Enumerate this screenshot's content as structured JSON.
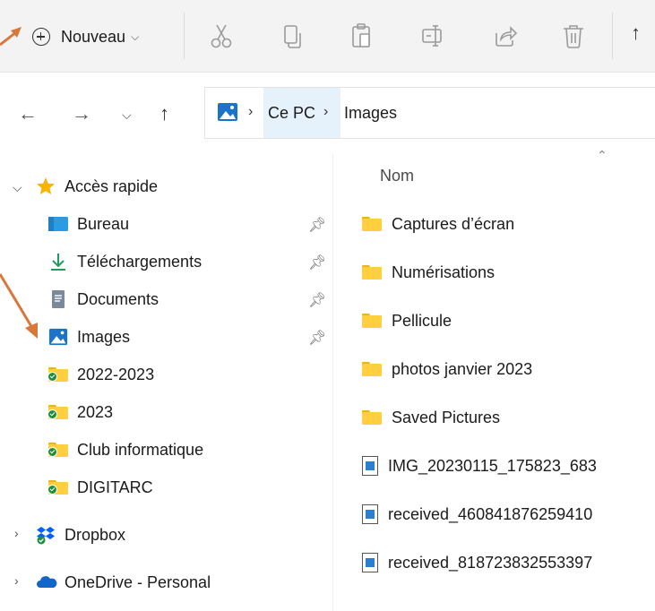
{
  "toolbar": {
    "new_label": "Nouveau",
    "icons": [
      "cut-icon",
      "copy-icon",
      "paste-icon",
      "rename-icon",
      "share-icon",
      "delete-icon",
      "sort-icon"
    ]
  },
  "address": {
    "crumbs": [
      "Ce PC",
      "Images"
    ]
  },
  "nav": {
    "quick_access": "Accès rapide",
    "items": [
      {
        "label": "Bureau",
        "icon": "desktop-icon",
        "pinned": true
      },
      {
        "label": "Téléchargements",
        "icon": "download-icon",
        "pinned": true
      },
      {
        "label": "Documents",
        "icon": "documents-icon",
        "pinned": true
      },
      {
        "label": "Images",
        "icon": "pictures-icon",
        "pinned": true
      },
      {
        "label": "2022-2023",
        "icon": "synced-folder-icon",
        "pinned": false
      },
      {
        "label": "2023",
        "icon": "synced-folder-icon",
        "pinned": false
      },
      {
        "label": "Club informatique",
        "icon": "synced-folder-icon",
        "pinned": false
      },
      {
        "label": "DIGITARC",
        "icon": "synced-folder-icon",
        "pinned": false
      }
    ],
    "dropbox": "Dropbox",
    "onedrive": "OneDrive - Personal"
  },
  "files": {
    "column_name": "Nom",
    "items": [
      {
        "name": "Captures d’écran",
        "type": "folder"
      },
      {
        "name": "Numérisations",
        "type": "folder"
      },
      {
        "name": "Pellicule",
        "type": "folder"
      },
      {
        "name": "photos janvier 2023",
        "type": "folder"
      },
      {
        "name": "Saved Pictures",
        "type": "folder"
      },
      {
        "name": "IMG_20230115_175823_683",
        "type": "image"
      },
      {
        "name": "received_460841876259410",
        "type": "image"
      },
      {
        "name": "received_818723832553397",
        "type": "image"
      }
    ]
  },
  "colors": {
    "annotation_arrow": "#d9773a",
    "selection": "#e5f1fb",
    "folder": "#ffcf3f",
    "sync": "#1e8e3e"
  }
}
